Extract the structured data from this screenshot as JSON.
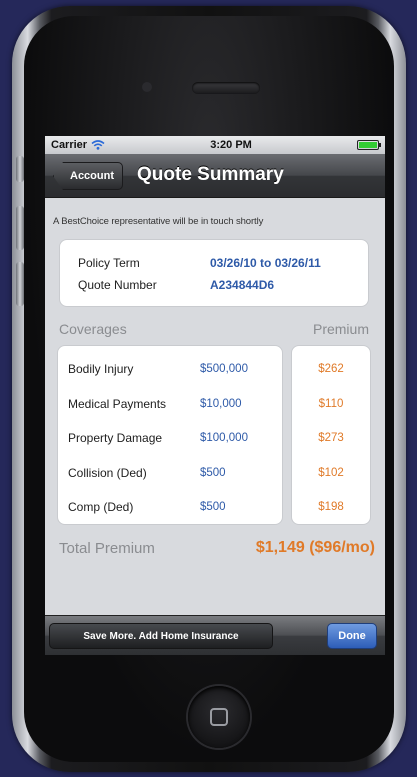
{
  "status_bar": {
    "carrier": "Carrier",
    "time": "3:20 PM",
    "battery_level": 1.0
  },
  "nav": {
    "back_label": "Account",
    "title": "Quote Summary"
  },
  "notice": "A BestChoice representative will be in touch shortly",
  "policy": {
    "term_label": "Policy Term",
    "term_value": "03/26/10 to 03/26/11",
    "quote_label": "Quote Number",
    "quote_value": "A234844D6"
  },
  "headers": {
    "coverages": "Coverages",
    "premium": "Premium"
  },
  "coverages": [
    {
      "name": "Bodily Injury",
      "limit": "$500,000",
      "premium": "$262"
    },
    {
      "name": "Medical Payments",
      "limit": "$10,000",
      "premium": "$110"
    },
    {
      "name": "Property Damage",
      "limit": "$100,000",
      "premium": "$273"
    },
    {
      "name": "Collision (Ded)",
      "limit": "$500",
      "premium": "$102"
    },
    {
      "name": "Comp (Ded)",
      "limit": "$500",
      "premium": "$198"
    }
  ],
  "total": {
    "label": "Total Premium",
    "value": "$1,149 ($96/mo)"
  },
  "toolbar": {
    "add_home_label": "Save More. Add Home Insurance",
    "done_label": "Done"
  },
  "colors": {
    "background": "#25285a",
    "link_blue": "#2e5aa8",
    "premium_orange": "#e07a28",
    "done_blue": "#2d5db8"
  }
}
